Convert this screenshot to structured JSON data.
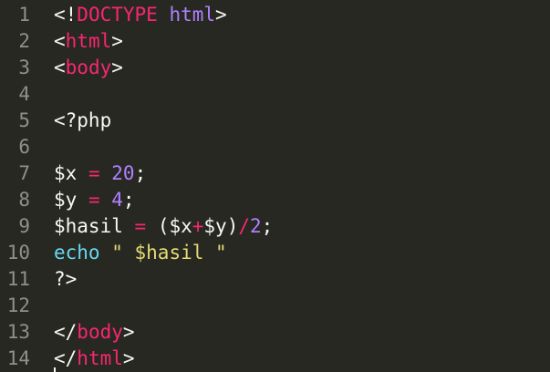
{
  "editor": {
    "colors": {
      "background": "#272822",
      "gutter_text": "#8f908a",
      "plain": "#f8f8f2",
      "keyword_tag": "#f92672",
      "number": "#ae81ff",
      "builtin": "#66d9ef",
      "string": "#e6db74"
    },
    "lines": [
      {
        "number": "1",
        "tokens": [
          {
            "text": "<!",
            "type": "pl"
          },
          {
            "text": "DOCTYPE",
            "type": "kw"
          },
          {
            "text": " ",
            "type": "pl"
          },
          {
            "text": "html",
            "type": "nm"
          },
          {
            "text": ">",
            "type": "pl"
          }
        ]
      },
      {
        "number": "2",
        "tokens": [
          {
            "text": "<",
            "type": "pl"
          },
          {
            "text": "html",
            "type": "kw"
          },
          {
            "text": ">",
            "type": "pl"
          }
        ]
      },
      {
        "number": "3",
        "tokens": [
          {
            "text": "<",
            "type": "pl"
          },
          {
            "text": "body",
            "type": "kw"
          },
          {
            "text": ">",
            "type": "pl"
          }
        ]
      },
      {
        "number": "4",
        "tokens": []
      },
      {
        "number": "5",
        "tokens": [
          {
            "text": "<?php",
            "type": "pl"
          }
        ]
      },
      {
        "number": "6",
        "tokens": []
      },
      {
        "number": "7",
        "tokens": [
          {
            "text": "$x",
            "type": "pl"
          },
          {
            "text": " ",
            "type": "pl"
          },
          {
            "text": "=",
            "type": "kw"
          },
          {
            "text": " ",
            "type": "pl"
          },
          {
            "text": "20",
            "type": "nm"
          },
          {
            "text": ";",
            "type": "pl"
          }
        ]
      },
      {
        "number": "8",
        "tokens": [
          {
            "text": "$y",
            "type": "pl"
          },
          {
            "text": " ",
            "type": "pl"
          },
          {
            "text": "=",
            "type": "kw"
          },
          {
            "text": " ",
            "type": "pl"
          },
          {
            "text": "4",
            "type": "nm"
          },
          {
            "text": ";",
            "type": "pl"
          }
        ]
      },
      {
        "number": "9",
        "tokens": [
          {
            "text": "$hasil",
            "type": "pl"
          },
          {
            "text": " ",
            "type": "pl"
          },
          {
            "text": "=",
            "type": "kw"
          },
          {
            "text": " ($x",
            "type": "pl"
          },
          {
            "text": "+",
            "type": "kw"
          },
          {
            "text": "$y)",
            "type": "pl"
          },
          {
            "text": "/",
            "type": "kw"
          },
          {
            "text": "2",
            "type": "nm"
          },
          {
            "text": ";",
            "type": "pl"
          }
        ]
      },
      {
        "number": "10",
        "tokens": [
          {
            "text": "echo",
            "type": "bi"
          },
          {
            "text": " ",
            "type": "pl"
          },
          {
            "text": "\" $hasil \"",
            "type": "st"
          }
        ]
      },
      {
        "number": "11",
        "tokens": [
          {
            "text": "?>",
            "type": "pl"
          }
        ]
      },
      {
        "number": "12",
        "tokens": []
      },
      {
        "number": "13",
        "tokens": [
          {
            "text": "</",
            "type": "pl"
          },
          {
            "text": "body",
            "type": "kw"
          },
          {
            "text": ">",
            "type": "pl"
          }
        ]
      },
      {
        "number": "14",
        "tokens": [
          {
            "text": "</",
            "type": "pl"
          },
          {
            "text": "html",
            "type": "kw"
          },
          {
            "text": ">",
            "type": "pl"
          }
        ]
      }
    ]
  }
}
